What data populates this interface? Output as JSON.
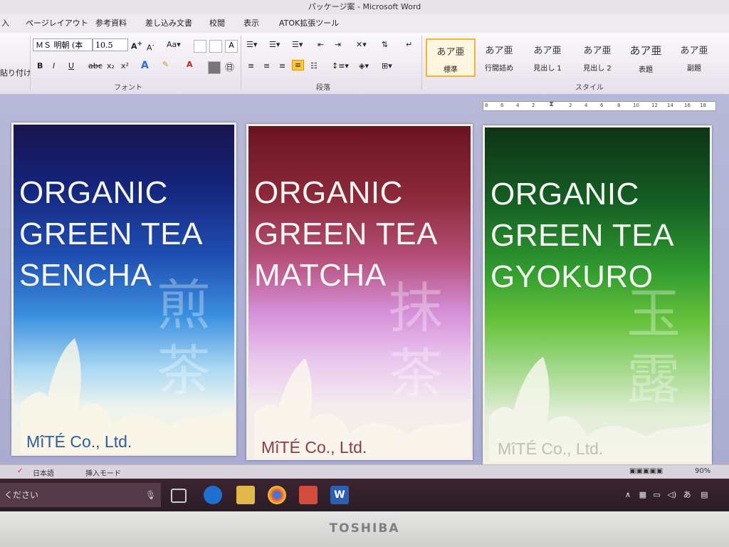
{
  "window": {
    "title": "パッケージ案 - Microsoft Word"
  },
  "ribbon": {
    "tabs": [
      "入",
      "ページレイアウト",
      "参考資料",
      "差し込み文書",
      "校閲",
      "表示",
      "ATOK拡張ツール"
    ],
    "clipboard_label": "貼り付け",
    "font_name": "ＭＳ 明朝 (本",
    "font_size": "10.5",
    "group_font": "フォント",
    "group_paragraph": "段落",
    "group_style": "スタイル",
    "styles": [
      {
        "sample": "あア亜",
        "name": "標準"
      },
      {
        "sample": "あア亜",
        "name": "行間詰め"
      },
      {
        "sample": "あア亜",
        "name": "見出し 1"
      },
      {
        "sample": "あア亜",
        "name": "見出し 2"
      },
      {
        "sample": "あア亜",
        "name": "表題"
      },
      {
        "sample": "あア亜",
        "name": "副題"
      }
    ]
  },
  "ruler": {
    "ticks": [
      "8",
      "6",
      "4",
      "2",
      "2",
      "4",
      "6",
      "8",
      "10",
      "12",
      "14",
      "16",
      "18"
    ]
  },
  "cards": [
    {
      "line1": "ORGANIC",
      "line2": "GREEN TEA",
      "line3": "SENCHA",
      "kanji1": "煎",
      "kanji2": "茶",
      "company": "MîTÉ Co., Ltd.",
      "company_color": "#2d5d9c"
    },
    {
      "line1": "ORGANIC",
      "line2": "GREEN TEA",
      "line3": "MATCHA",
      "kanji1": "抹",
      "kanji2": "茶",
      "company": "MîTÉ Co., Ltd.",
      "company_color": "#8a3a4e"
    },
    {
      "line1": "ORGANIC",
      "line2": "GREEN TEA",
      "line3": "GYOKURO",
      "kanji1": "玉",
      "kanji2": "露",
      "company": "MîTÉ Co., Ltd.",
      "company_color": "#b9c4b3"
    }
  ],
  "statusbar": {
    "language": "日本語",
    "mode": "挿入モード",
    "zoom": "90%"
  },
  "taskbar": {
    "search_placeholder": "ください",
    "ime": "あ"
  },
  "bezel": {
    "brand": "TOSHIBA"
  }
}
